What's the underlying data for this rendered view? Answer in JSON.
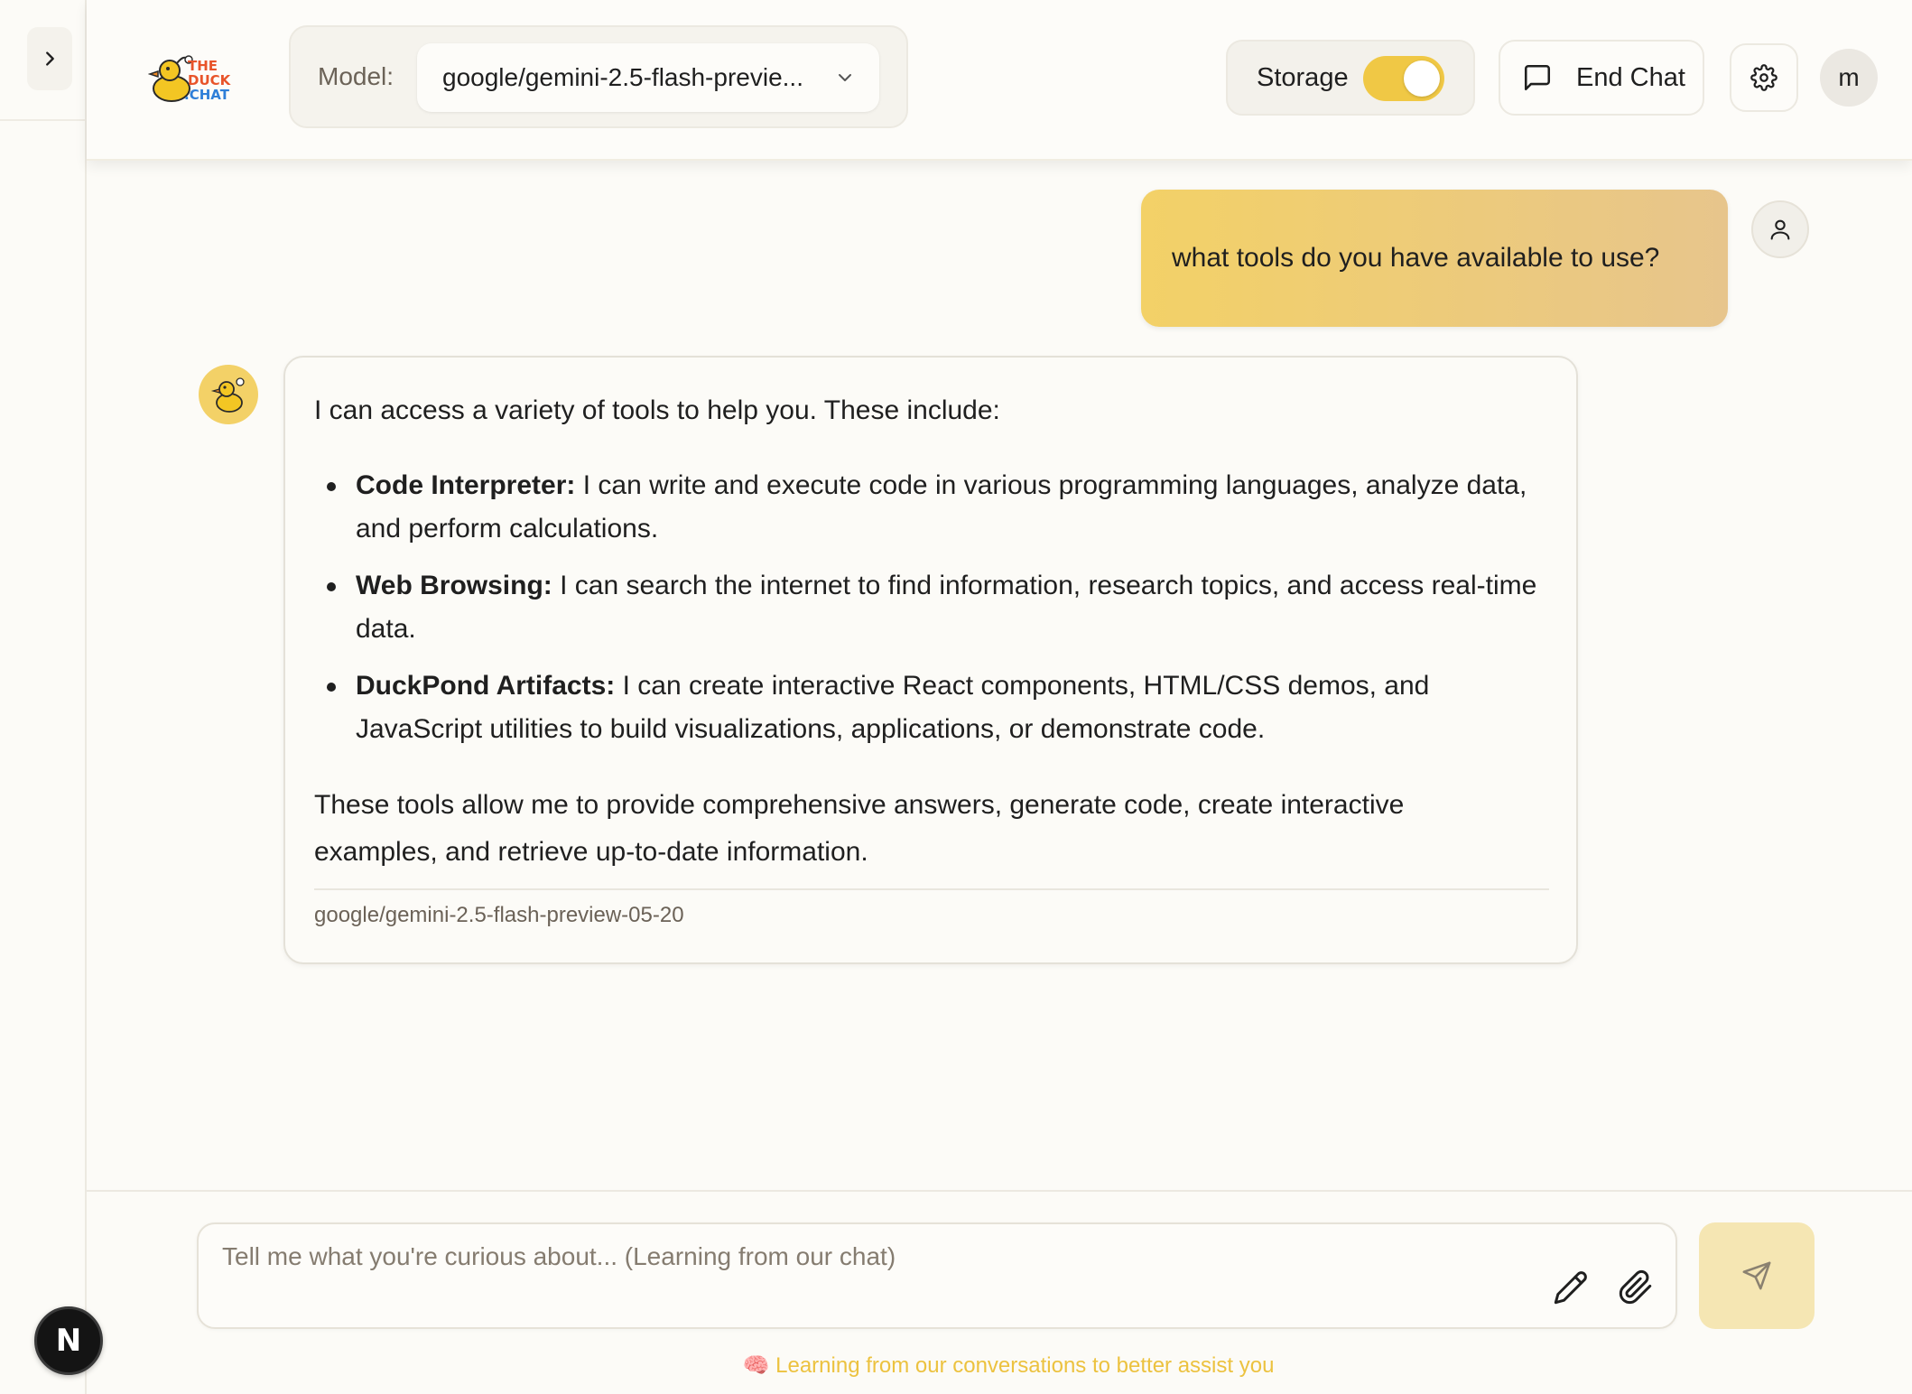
{
  "header": {
    "logo_text_1": "THE",
    "logo_text_2": "DUCK",
    "logo_text_3": ".CHAT",
    "model_label": "Model:",
    "model_selected": "google/gemini-2.5-flash-previe...",
    "storage_label": "Storage",
    "storage_enabled": true,
    "end_chat_label": "End Chat",
    "user_initial": "m"
  },
  "messages": {
    "user": "what tools do you have available to use?",
    "assistant": {
      "intro": "I can access a variety of tools to help you. These include:",
      "items": [
        {
          "title": "Code Interpreter:",
          "text": " I can write and execute code in various programming languages, analyze data, and perform calculations."
        },
        {
          "title": "Web Browsing:",
          "text": " I can search the internet to find information, research topics, and access real-time data."
        },
        {
          "title": "DuckPond Artifacts:",
          "text": " I can create interactive React components, HTML/CSS demos, and JavaScript utilities to build visualizations, applications, or demonstrate code."
        }
      ],
      "outro": "These tools allow me to provide comprehensive answers, generate code, create interactive examples, and retrieve up-to-date information.",
      "model": "google/gemini-2.5-flash-preview-05-20"
    }
  },
  "composer": {
    "placeholder": "Tell me what you're curious about... (Learning from our chat)",
    "footer_note": "🧠 Learning from our conversations to better assist you"
  },
  "misc": {
    "n_badge": "N"
  },
  "colors": {
    "accent": "#f0c845",
    "user_bubble_start": "#f3d167",
    "user_bubble_end": "#e7c58c",
    "send_button": "#f5e6b3"
  },
  "icons": {
    "sidebar_toggle": "chevron-right-icon",
    "model_dropdown": "chevron-down-icon",
    "end_chat": "message-square-icon",
    "settings": "gear-icon",
    "user": "user-icon",
    "pen": "pencil-icon",
    "attach": "paperclip-icon",
    "send": "send-icon"
  }
}
